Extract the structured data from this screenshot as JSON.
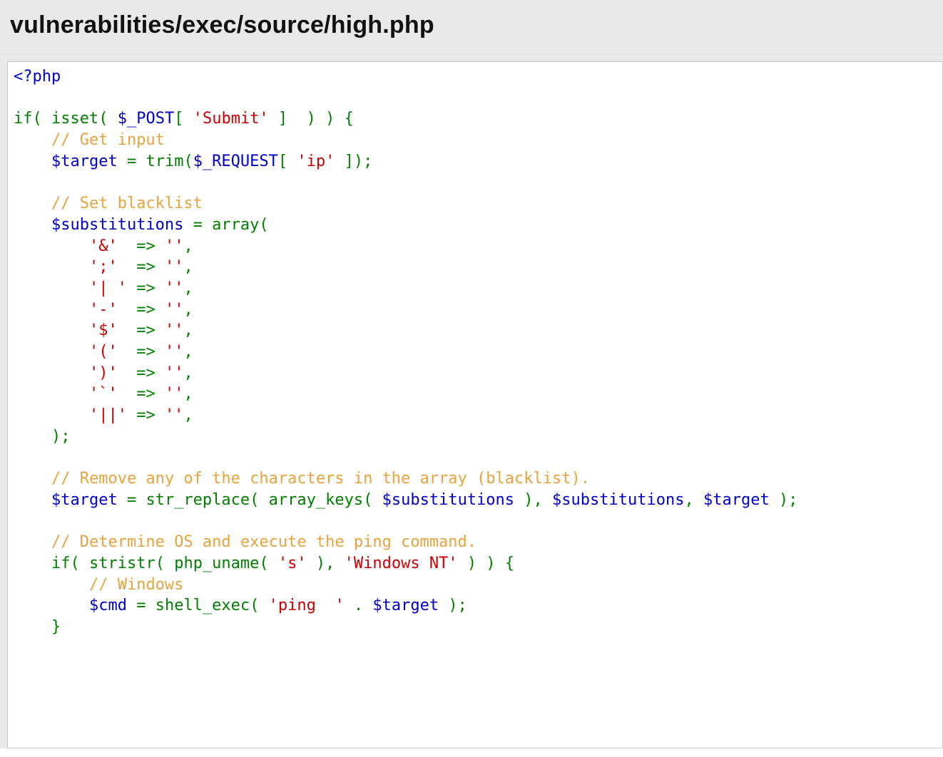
{
  "header": {
    "title": "vulnerabilities/exec/source/high.php"
  },
  "code": {
    "tokens": [
      {
        "c": "t-php",
        "t": "<?php"
      },
      {
        "c": "",
        "t": "\n"
      },
      {
        "c": "",
        "t": "\n"
      },
      {
        "c": "t-kw",
        "t": "if"
      },
      {
        "c": "t-punc",
        "t": "( "
      },
      {
        "c": "t-kw",
        "t": "isset"
      },
      {
        "c": "t-punc",
        "t": "( "
      },
      {
        "c": "t-var",
        "t": "$_POST"
      },
      {
        "c": "t-punc",
        "t": "[ "
      },
      {
        "c": "t-str",
        "t": "'Submit'"
      },
      {
        "c": "t-punc",
        "t": " ]  ) ) {"
      },
      {
        "c": "",
        "t": "\n"
      },
      {
        "c": "",
        "t": "    "
      },
      {
        "c": "t-comm",
        "t": "// Get input"
      },
      {
        "c": "",
        "t": "\n"
      },
      {
        "c": "",
        "t": "    "
      },
      {
        "c": "t-var",
        "t": "$target"
      },
      {
        "c": "t-punc",
        "t": " = "
      },
      {
        "c": "t-kw",
        "t": "trim"
      },
      {
        "c": "t-punc",
        "t": "("
      },
      {
        "c": "t-var",
        "t": "$_REQUEST"
      },
      {
        "c": "t-punc",
        "t": "[ "
      },
      {
        "c": "t-str",
        "t": "'ip'"
      },
      {
        "c": "t-punc",
        "t": " ]);"
      },
      {
        "c": "",
        "t": "\n"
      },
      {
        "c": "",
        "t": "\n"
      },
      {
        "c": "",
        "t": "    "
      },
      {
        "c": "t-comm",
        "t": "// Set blacklist"
      },
      {
        "c": "",
        "t": "\n"
      },
      {
        "c": "",
        "t": "    "
      },
      {
        "c": "t-var",
        "t": "$substitutions"
      },
      {
        "c": "t-punc",
        "t": " = "
      },
      {
        "c": "t-kw",
        "t": "array"
      },
      {
        "c": "t-punc",
        "t": "("
      },
      {
        "c": "",
        "t": "\n"
      },
      {
        "c": "",
        "t": "        "
      },
      {
        "c": "t-str",
        "t": "'&'"
      },
      {
        "c": "t-punc",
        "t": "  => "
      },
      {
        "c": "t-str",
        "t": "''"
      },
      {
        "c": "t-punc",
        "t": ","
      },
      {
        "c": "",
        "t": "\n"
      },
      {
        "c": "",
        "t": "        "
      },
      {
        "c": "t-str",
        "t": "';'"
      },
      {
        "c": "t-punc",
        "t": "  => "
      },
      {
        "c": "t-str",
        "t": "''"
      },
      {
        "c": "t-punc",
        "t": ","
      },
      {
        "c": "",
        "t": "\n"
      },
      {
        "c": "",
        "t": "        "
      },
      {
        "c": "t-str",
        "t": "'| '"
      },
      {
        "c": "t-punc",
        "t": " => "
      },
      {
        "c": "t-str",
        "t": "''"
      },
      {
        "c": "t-punc",
        "t": ","
      },
      {
        "c": "",
        "t": "\n"
      },
      {
        "c": "",
        "t": "        "
      },
      {
        "c": "t-str",
        "t": "'-'"
      },
      {
        "c": "t-punc",
        "t": "  => "
      },
      {
        "c": "t-str",
        "t": "''"
      },
      {
        "c": "t-punc",
        "t": ","
      },
      {
        "c": "",
        "t": "\n"
      },
      {
        "c": "",
        "t": "        "
      },
      {
        "c": "t-str",
        "t": "'$'"
      },
      {
        "c": "t-punc",
        "t": "  => "
      },
      {
        "c": "t-str",
        "t": "''"
      },
      {
        "c": "t-punc",
        "t": ","
      },
      {
        "c": "",
        "t": "\n"
      },
      {
        "c": "",
        "t": "        "
      },
      {
        "c": "t-str",
        "t": "'('"
      },
      {
        "c": "t-punc",
        "t": "  => "
      },
      {
        "c": "t-str",
        "t": "''"
      },
      {
        "c": "t-punc",
        "t": ","
      },
      {
        "c": "",
        "t": "\n"
      },
      {
        "c": "",
        "t": "        "
      },
      {
        "c": "t-str",
        "t": "')'"
      },
      {
        "c": "t-punc",
        "t": "  => "
      },
      {
        "c": "t-str",
        "t": "''"
      },
      {
        "c": "t-punc",
        "t": ","
      },
      {
        "c": "",
        "t": "\n"
      },
      {
        "c": "",
        "t": "        "
      },
      {
        "c": "t-str",
        "t": "'`'"
      },
      {
        "c": "t-punc",
        "t": "  => "
      },
      {
        "c": "t-str",
        "t": "''"
      },
      {
        "c": "t-punc",
        "t": ","
      },
      {
        "c": "",
        "t": "\n"
      },
      {
        "c": "",
        "t": "        "
      },
      {
        "c": "t-str",
        "t": "'||'"
      },
      {
        "c": "t-punc",
        "t": " => "
      },
      {
        "c": "t-str",
        "t": "''"
      },
      {
        "c": "t-punc",
        "t": ","
      },
      {
        "c": "",
        "t": "\n"
      },
      {
        "c": "",
        "t": "    "
      },
      {
        "c": "t-punc",
        "t": ");"
      },
      {
        "c": "",
        "t": "\n"
      },
      {
        "c": "",
        "t": "\n"
      },
      {
        "c": "",
        "t": "    "
      },
      {
        "c": "t-comm",
        "t": "// Remove any of the characters in the array (blacklist)."
      },
      {
        "c": "",
        "t": "\n"
      },
      {
        "c": "",
        "t": "    "
      },
      {
        "c": "t-var",
        "t": "$target"
      },
      {
        "c": "t-punc",
        "t": " = "
      },
      {
        "c": "t-kw",
        "t": "str_replace"
      },
      {
        "c": "t-punc",
        "t": "( "
      },
      {
        "c": "t-kw",
        "t": "array_keys"
      },
      {
        "c": "t-punc",
        "t": "( "
      },
      {
        "c": "t-var",
        "t": "$substitutions"
      },
      {
        "c": "t-punc",
        "t": " ), "
      },
      {
        "c": "t-var",
        "t": "$substitutions"
      },
      {
        "c": "t-punc",
        "t": ", "
      },
      {
        "c": "t-var",
        "t": "$target"
      },
      {
        "c": "t-punc",
        "t": " );"
      },
      {
        "c": "",
        "t": "\n"
      },
      {
        "c": "",
        "t": "\n"
      },
      {
        "c": "",
        "t": "    "
      },
      {
        "c": "t-comm",
        "t": "// Determine OS and execute the ping command."
      },
      {
        "c": "",
        "t": "\n"
      },
      {
        "c": "",
        "t": "    "
      },
      {
        "c": "t-kw",
        "t": "if"
      },
      {
        "c": "t-punc",
        "t": "( "
      },
      {
        "c": "t-kw",
        "t": "stristr"
      },
      {
        "c": "t-punc",
        "t": "( "
      },
      {
        "c": "t-kw",
        "t": "php_uname"
      },
      {
        "c": "t-punc",
        "t": "( "
      },
      {
        "c": "t-str",
        "t": "'s'"
      },
      {
        "c": "t-punc",
        "t": " ), "
      },
      {
        "c": "t-str",
        "t": "'Windows NT'"
      },
      {
        "c": "t-punc",
        "t": " ) ) {"
      },
      {
        "c": "",
        "t": "\n"
      },
      {
        "c": "",
        "t": "        "
      },
      {
        "c": "t-comm",
        "t": "// Windows"
      },
      {
        "c": "",
        "t": "\n"
      },
      {
        "c": "",
        "t": "        "
      },
      {
        "c": "t-var",
        "t": "$cmd"
      },
      {
        "c": "t-punc",
        "t": " = "
      },
      {
        "c": "t-kw",
        "t": "shell_exec"
      },
      {
        "c": "t-punc",
        "t": "( "
      },
      {
        "c": "t-str",
        "t": "'ping  '"
      },
      {
        "c": "t-punc",
        "t": " . "
      },
      {
        "c": "t-var",
        "t": "$target"
      },
      {
        "c": "t-punc",
        "t": " );"
      },
      {
        "c": "",
        "t": "\n"
      },
      {
        "c": "",
        "t": "    "
      },
      {
        "c": "t-punc",
        "t": "}"
      }
    ]
  }
}
